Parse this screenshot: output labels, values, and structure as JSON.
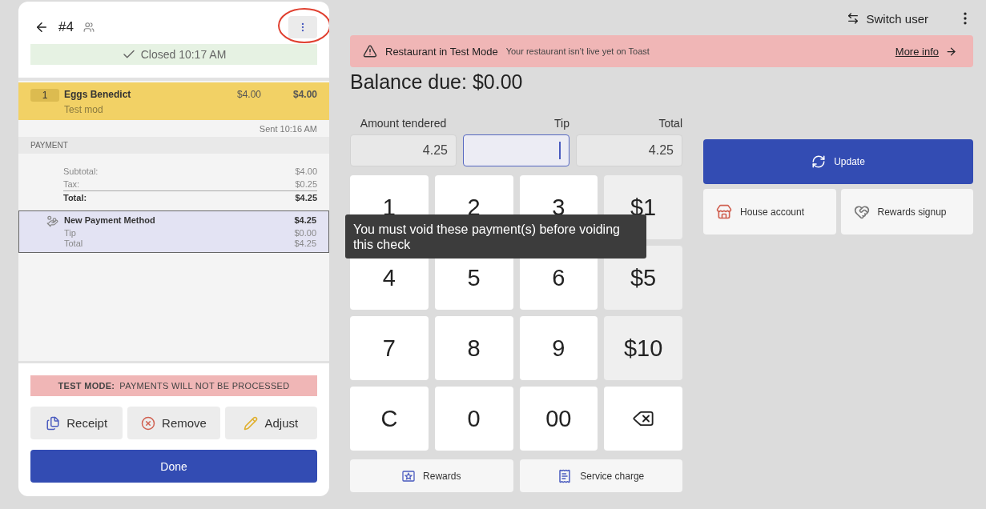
{
  "check": {
    "title": "#4",
    "status": "Closed 10:17 AM",
    "items": [
      {
        "qty": "1",
        "name": "Eggs Benedict",
        "modifier": "Test mod",
        "price": "$4.00",
        "total": "$4.00",
        "selected": true
      }
    ],
    "sent": "Sent 10:16 AM",
    "payment_header": "PAYMENT",
    "totals": [
      {
        "label": "Subtotal:",
        "value": "$4.00",
        "kind": "line"
      },
      {
        "label": "Tax:",
        "value": "$0.25",
        "kind": "line"
      },
      {
        "label": "Total:",
        "value": "$4.25",
        "kind": "total"
      }
    ],
    "payment": {
      "name": "New Payment Method",
      "amount": "$4.25",
      "selected": true,
      "lines": [
        {
          "label": "Tip",
          "value": "$0.00"
        },
        {
          "label": "Total",
          "value": "$4.25"
        }
      ]
    },
    "test_banner": {
      "label": "TEST MODE:",
      "text": "PAYMENTS WILL NOT BE PROCESSED"
    },
    "actions": [
      {
        "label": "Receipt",
        "kind": "receipt"
      },
      {
        "label": "Remove",
        "kind": "remove"
      },
      {
        "label": "Adjust",
        "kind": "adjust"
      }
    ],
    "done": "Done"
  },
  "top_bar": {
    "switch_user": "Switch user"
  },
  "alert": {
    "title": "Restaurant in Test Mode",
    "text": "Your restaurant isn’t live yet on Toast",
    "link": "More info"
  },
  "balance": "Balance due: $0.00",
  "fields": [
    {
      "label": "Amount tendered",
      "value": "4.25",
      "focused": false
    },
    {
      "label": "Tip",
      "focused": true
    },
    {
      "label": "Total",
      "value": "4.25",
      "focused": false
    }
  ],
  "keypad": [
    {
      "label": "1",
      "kind": "digit"
    },
    {
      "label": "2",
      "kind": "digit"
    },
    {
      "label": "3",
      "kind": "digit"
    },
    {
      "label": "$1",
      "kind": "quick"
    },
    {
      "label": "4",
      "kind": "digit"
    },
    {
      "label": "5",
      "kind": "digit"
    },
    {
      "label": "6",
      "kind": "digit"
    },
    {
      "label": "$5",
      "kind": "quick"
    },
    {
      "label": "7",
      "kind": "digit"
    },
    {
      "label": "8",
      "kind": "digit"
    },
    {
      "label": "9",
      "kind": "digit"
    },
    {
      "label": "$10",
      "kind": "quick"
    },
    {
      "label": "C",
      "kind": "digit"
    },
    {
      "label": "0",
      "kind": "digit"
    },
    {
      "label": "00",
      "kind": "digit"
    },
    {
      "kind": "backspace"
    }
  ],
  "keypad_actions": [
    {
      "label": "Rewards",
      "kind": "rewards"
    },
    {
      "label": "Service charge",
      "kind": "service"
    }
  ],
  "tooltip": "You must void these payment(s) before voiding this check",
  "side": {
    "update": "Update",
    "options": [
      {
        "label": "House account",
        "kind": "house"
      },
      {
        "label": "Rewards signup",
        "kind": "signup"
      }
    ]
  }
}
